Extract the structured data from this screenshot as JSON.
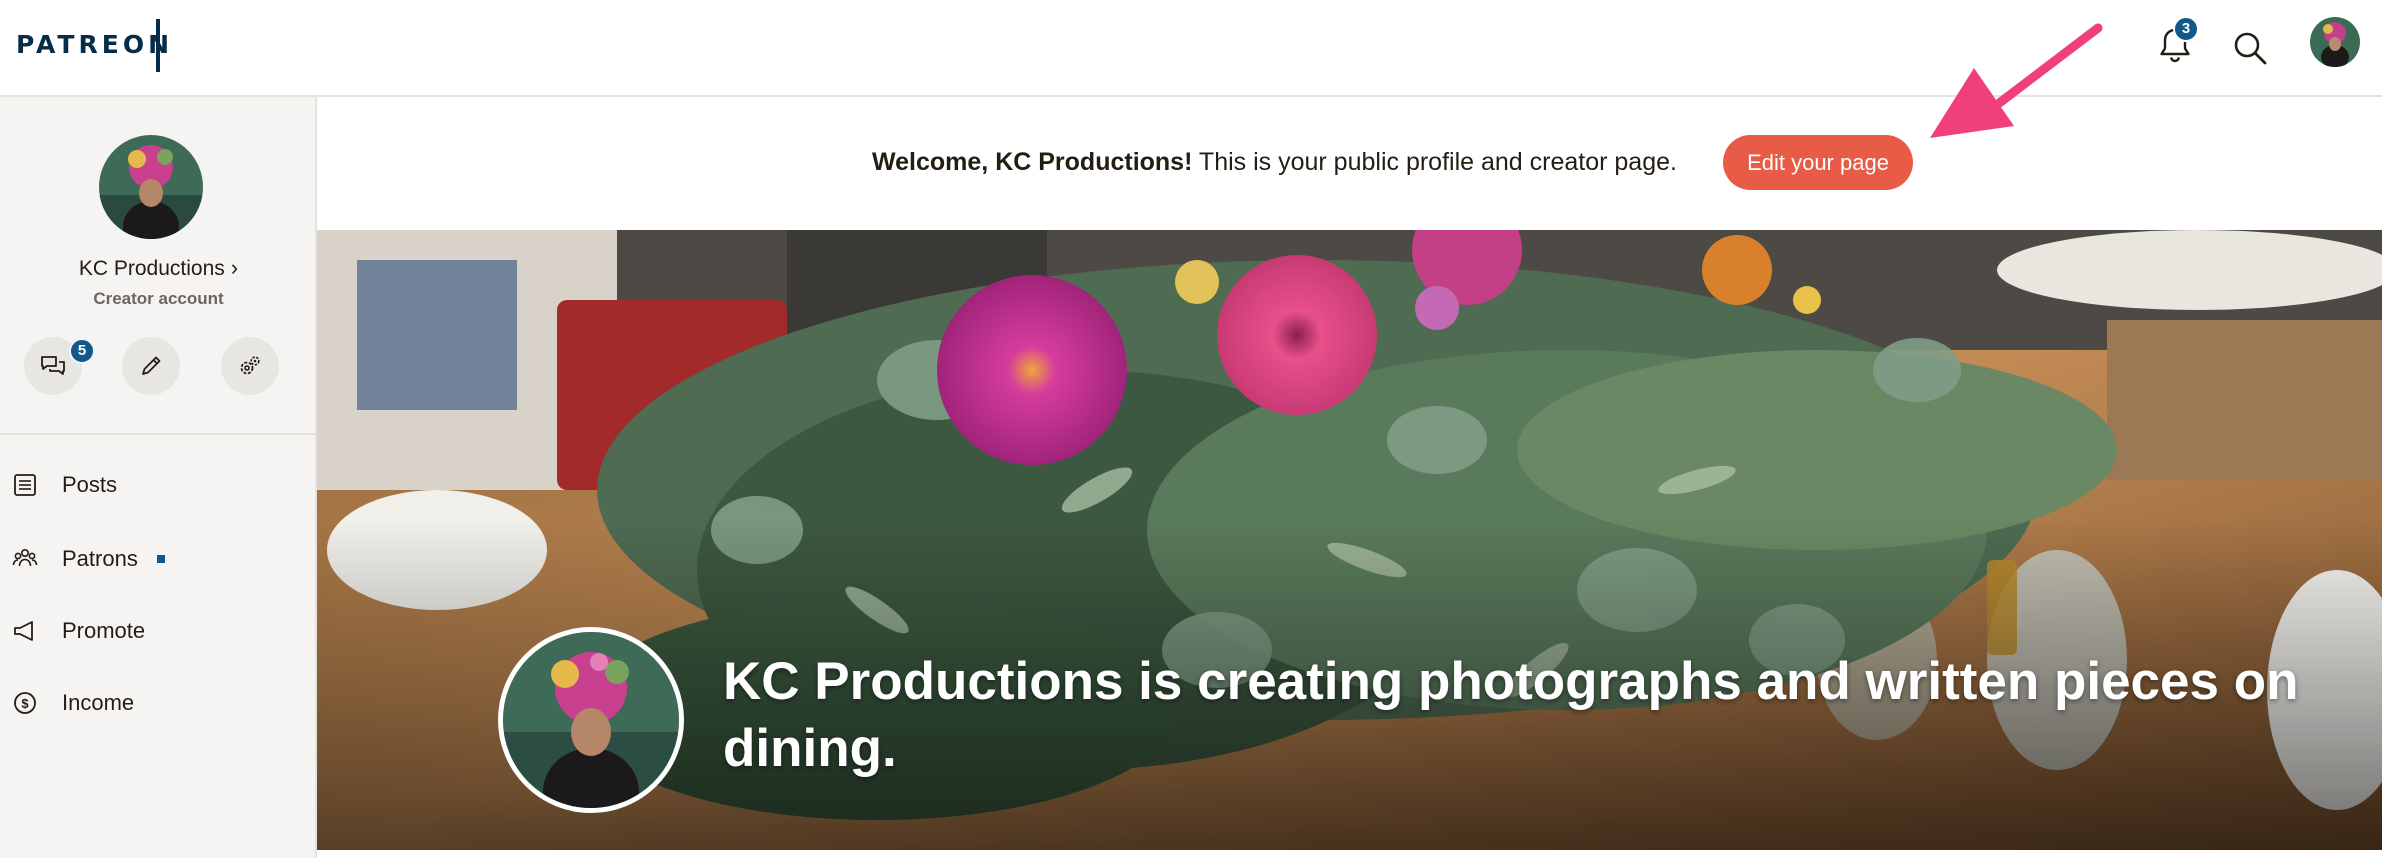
{
  "header": {
    "logo_text": "PATREON",
    "notifications_count": "3",
    "icons": [
      "bell-icon",
      "search-icon",
      "avatar"
    ]
  },
  "sidebar": {
    "account_name": "KC Productions",
    "account_type": "Creator account",
    "messages_count": "5",
    "quick_actions": [
      "chat-icon",
      "pencil-icon",
      "gears-icon"
    ],
    "nav": [
      {
        "label": "Posts",
        "icon": "document-icon"
      },
      {
        "label": "Patrons",
        "icon": "people-icon"
      },
      {
        "label": "Promote",
        "icon": "megaphone-icon"
      },
      {
        "label": "Income",
        "icon": "dollar-circle-icon"
      }
    ]
  },
  "welcome": {
    "greeting": "Welcome, KC Productions!",
    "message": "This is your public profile and creator page.",
    "edit_button": "Edit your page"
  },
  "cover": {
    "headline": "KC Productions is creating photographs and written pieces on dining."
  },
  "colors": {
    "brand_navy": "#052d49",
    "badge_blue": "#0f5a8a",
    "edit_button": "#e85b46",
    "arrow_pink": "#f0407a"
  }
}
